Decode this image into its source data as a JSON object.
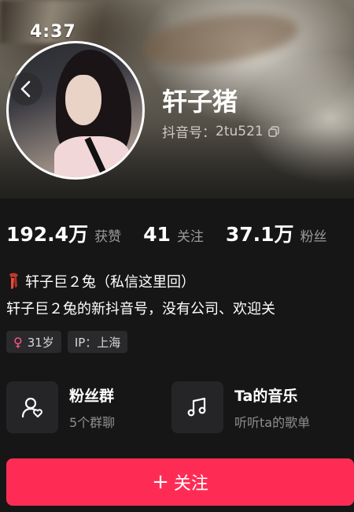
{
  "status_bar": {
    "time": "4:37"
  },
  "profile": {
    "username": "轩子猪",
    "douyin_id_label": "抖音号：",
    "douyin_id": "2tu521"
  },
  "stats": [
    {
      "value": "192.4万",
      "label": "获赞"
    },
    {
      "value": "41",
      "label": "关注"
    },
    {
      "value": "37.1万",
      "label": "粉丝"
    }
  ],
  "bio": {
    "line1": "轩子巨２兔（私信这里回）",
    "line2": "轩子巨２兔的新抖音号，没有公司、欢迎关"
  },
  "tags": {
    "age": "31岁",
    "ip": "IP：上海"
  },
  "cards": {
    "fan_group": {
      "title": "粉丝群",
      "subtitle": "5个群聊",
      "icon": "fan-group-icon"
    },
    "music": {
      "title": "Ta的音乐",
      "subtitle": "听听ta的歌单",
      "icon": "music-note-icon"
    }
  },
  "follow_button": {
    "label": "关注",
    "icon": "plus"
  },
  "colors": {
    "accent": "#fe2c55",
    "background": "#161616",
    "gender_female": "#ff5a87"
  }
}
